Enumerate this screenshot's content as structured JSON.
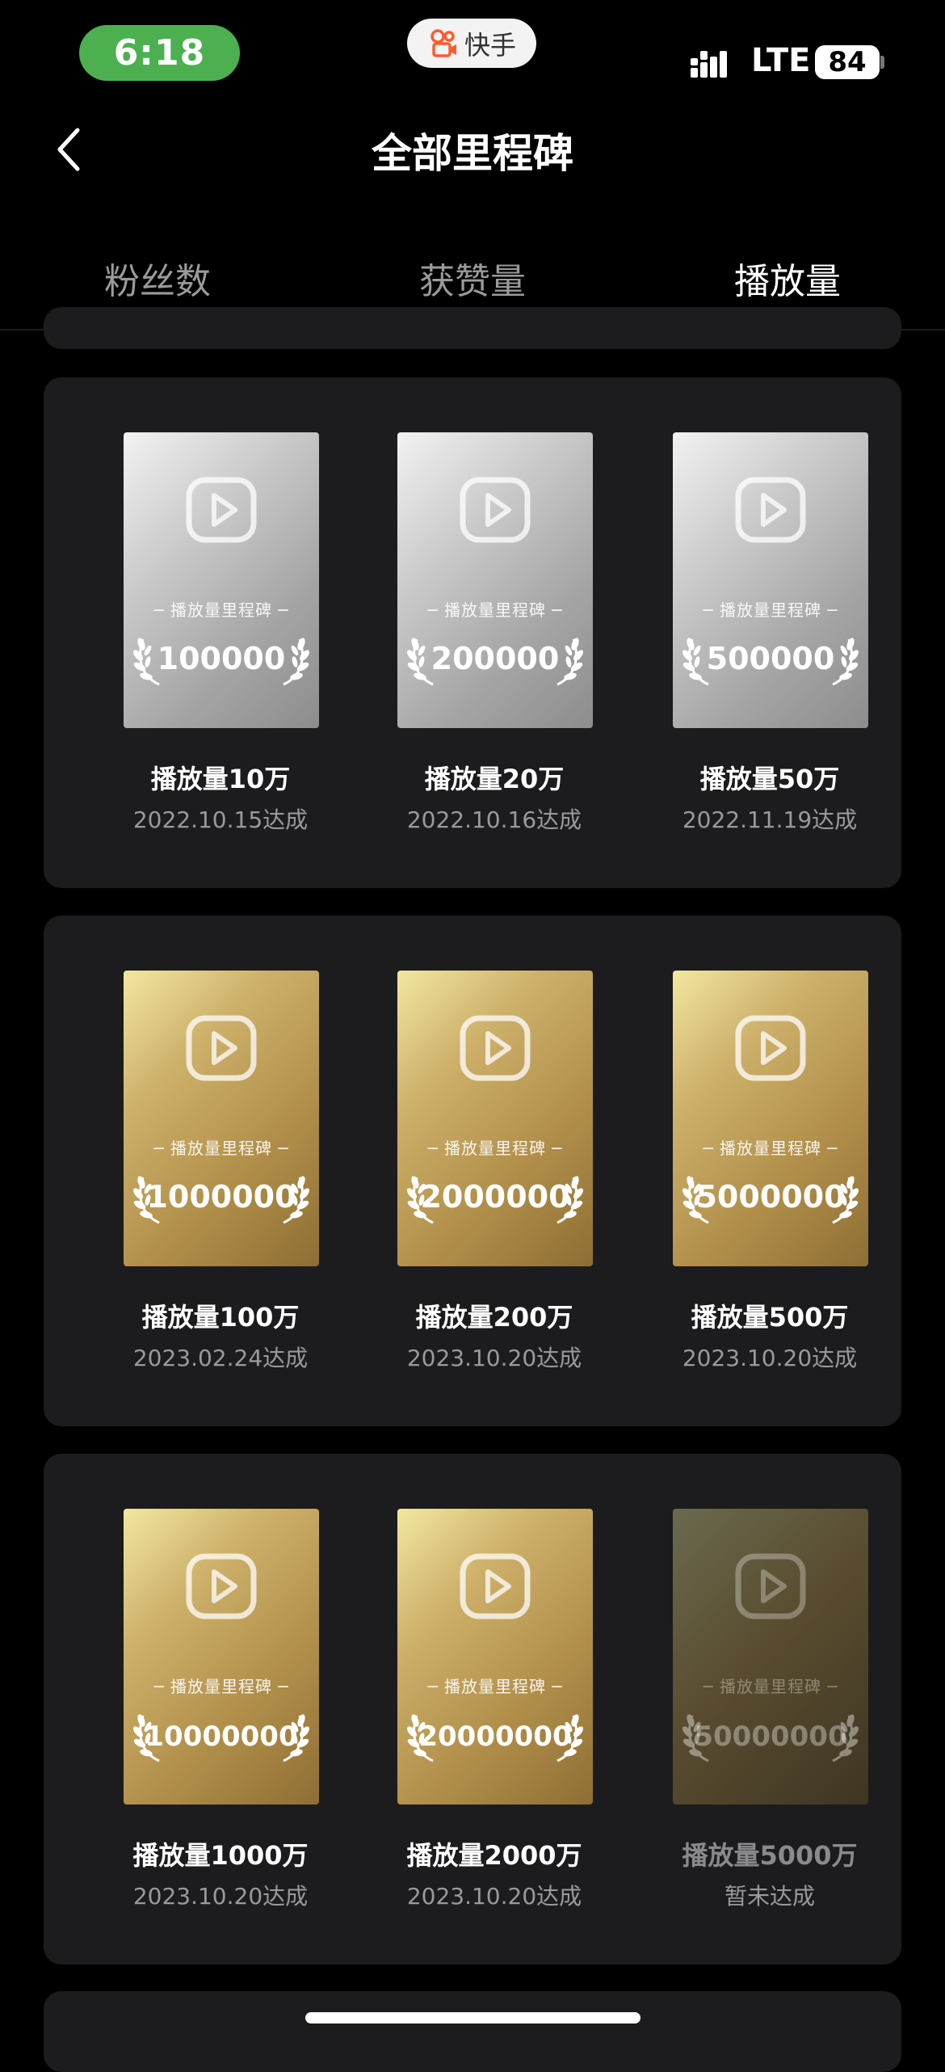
{
  "status": {
    "time": "6:18",
    "app_name": "快手",
    "network": "LTE",
    "battery": "84"
  },
  "nav": {
    "title": "全部里程碑"
  },
  "tabs": [
    {
      "label": "粉丝数",
      "active": false
    },
    {
      "label": "获赞量",
      "active": false
    },
    {
      "label": "播放量",
      "active": true
    }
  ],
  "medal_caption": "─ 播放量里程碑 ─",
  "colors": {
    "background": "#000000",
    "card": "#1c1c1e",
    "status_pill": "#4cb051",
    "secondary_text": "#9a9a9c"
  },
  "milestones": [
    {
      "number": "100000",
      "name": "播放量10万",
      "date": "2022.10.15达成",
      "tier": "silver",
      "achieved": true
    },
    {
      "number": "200000",
      "name": "播放量20万",
      "date": "2022.10.16达成",
      "tier": "silver",
      "achieved": true
    },
    {
      "number": "500000",
      "name": "播放量50万",
      "date": "2022.11.19达成",
      "tier": "silver",
      "achieved": true
    },
    {
      "number": "1000000",
      "name": "播放量100万",
      "date": "2023.02.24达成",
      "tier": "gold",
      "achieved": true
    },
    {
      "number": "2000000",
      "name": "播放量200万",
      "date": "2023.10.20达成",
      "tier": "gold",
      "achieved": true
    },
    {
      "number": "5000000",
      "name": "播放量500万",
      "date": "2023.10.20达成",
      "tier": "gold",
      "achieved": true
    },
    {
      "number": "10000000",
      "name": "播放量1000万",
      "date": "2023.10.20达成",
      "tier": "gold",
      "achieved": true
    },
    {
      "number": "20000000",
      "name": "播放量2000万",
      "date": "2023.10.20达成",
      "tier": "gold",
      "achieved": true
    },
    {
      "number": "50000000",
      "name": "播放量5000万",
      "date": "暂未达成",
      "tier": "locked",
      "achieved": false
    }
  ]
}
